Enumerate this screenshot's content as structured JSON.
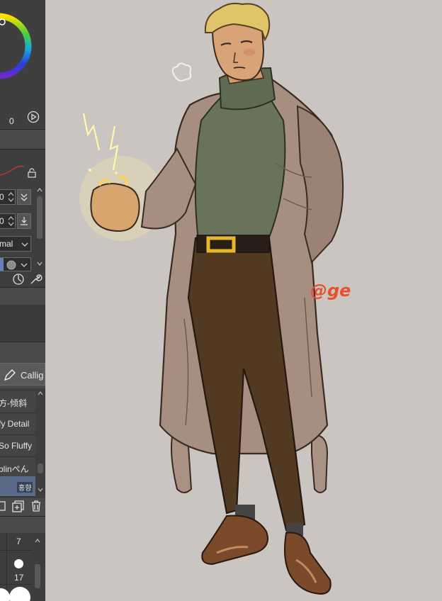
{
  "colors": {
    "panel_bg": "#4a4a4a",
    "canvas_bg": "#cbc5c2",
    "selected_row": "#5c6a8a",
    "signature": "#e8502a"
  },
  "color_wheel": {
    "opacity_value": "0"
  },
  "tool_property": {
    "size_value": "0",
    "opacity_value": "0",
    "blend_mode": "mal"
  },
  "brush_tab": {
    "label": "Callig"
  },
  "brush_list": {
    "items": [
      {
        "label": "方-倾斜"
      },
      {
        "label": "fy Detail"
      },
      {
        "label": "So Fluffy"
      },
      {
        "label": "blinぺん"
      },
      {
        "label": "홍향"
      }
    ]
  },
  "brush_size": {
    "values": [
      "7",
      "17"
    ]
  },
  "canvas": {
    "signature_text": "@ge"
  }
}
